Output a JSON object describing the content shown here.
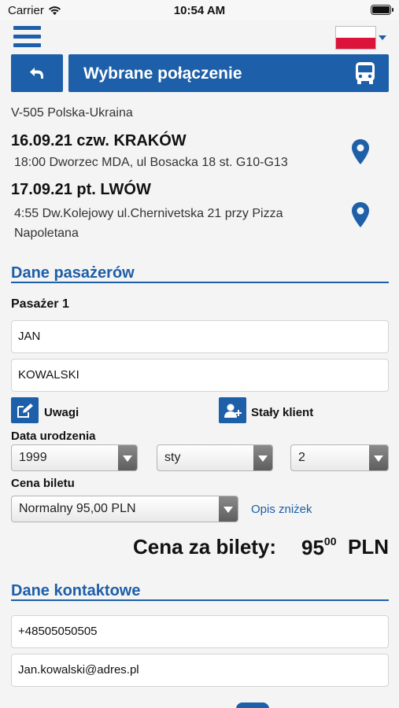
{
  "status_bar": {
    "carrier": "Carrier",
    "time": "10:54 AM"
  },
  "header": {
    "title": "Wybrane połączenie"
  },
  "route": {
    "name": "V-505 Polska-Ukraina",
    "departure": {
      "heading": "16.09.21 czw. KRAKÓW",
      "address": "18:00 Dworzec MDA, ul Bosacka 18 st. G10-G13"
    },
    "arrival": {
      "heading": "17.09.21 pt. LWÓW",
      "address": "4:55 Dw.Kolejowy ul.Chernivetska 21 przy Pizza Napoletana"
    }
  },
  "passengers": {
    "section_title": "Dane pasażerów",
    "passenger_label": "Pasażer 1",
    "first_name": "JAN",
    "last_name": "KOWALSKI",
    "notes_label": "Uwagi",
    "regular_client_label": "Stały klient",
    "birth_date_label": "Data urodzenia",
    "birth_year": "1999",
    "birth_month": "sty",
    "birth_day": "2",
    "ticket_price_label": "Cena biletu",
    "ticket_type": "Normalny 95,00 PLN",
    "discounts_link": "Opis zniżek"
  },
  "total": {
    "label": "Cena za bilety:",
    "amount": "95",
    "cents": "00",
    "currency": "PLN"
  },
  "contact": {
    "section_title": "Dane kontaktowe",
    "phone": "+48505050505",
    "email": "Jan.kowalski@adres.pl"
  },
  "colors": {
    "brand": "#1d5fa8",
    "background": "#f4f4f4"
  },
  "icons": {
    "menu": "hamburger-icon",
    "back": "back-arrow-icon",
    "bus": "bus-icon",
    "pin": "map-pin-icon",
    "edit": "edit-icon",
    "add_user": "add-user-icon"
  }
}
